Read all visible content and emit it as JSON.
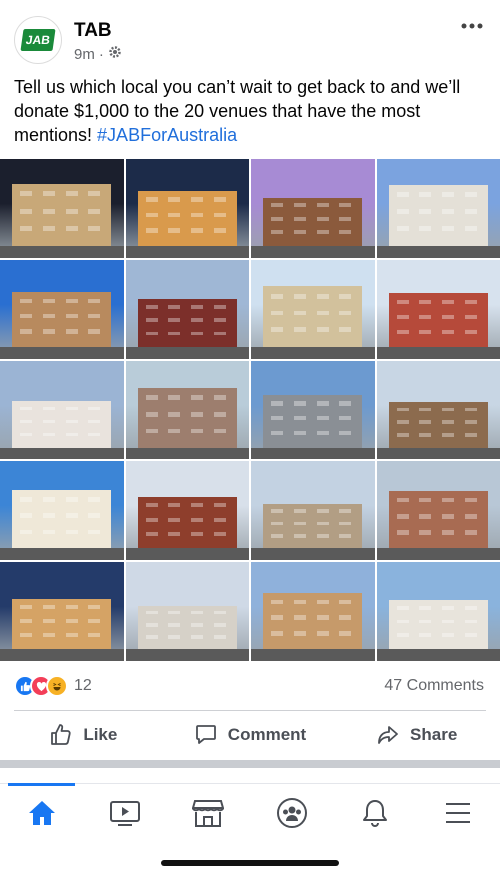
{
  "post": {
    "page_name": "TAB",
    "avatar_text": "JAB",
    "time": "9m",
    "text": "Tell us which local you can’t wait to get back to and we’ll donate $1,000 to the 20 venues that have the most mentions! ",
    "hashtag": "#JABForAustralia"
  },
  "photos": [
    {
      "sky": "#1b1f2d",
      "body": "#c8a878"
    },
    {
      "sky": "#1c2b49",
      "body": "#d99a4c"
    },
    {
      "sky": "#a78bd4",
      "body": "#8b5a3c"
    },
    {
      "sky": "#7ba3df",
      "body": "#e4e0d7"
    },
    {
      "sky": "#2a6fd1",
      "body": "#b88a5e"
    },
    {
      "sky": "#9fb7d5",
      "body": "#7c2f2a"
    },
    {
      "sky": "#cfe0f0",
      "body": "#d2c19c"
    },
    {
      "sky": "#d7e2ee",
      "body": "#b64a3a"
    },
    {
      "sky": "#9bb4d4",
      "body": "#e9e3dd"
    },
    {
      "sky": "#b9ccd9",
      "body": "#9d7e6e"
    },
    {
      "sky": "#6c9ad0",
      "body": "#8a8f95"
    },
    {
      "sky": "#c8d6e4",
      "body": "#8c6b4e"
    },
    {
      "sky": "#3c85d6",
      "body": "#efe8d8"
    },
    {
      "sky": "#d8e0ea",
      "body": "#8e3e2c"
    },
    {
      "sky": "#c3d2e2",
      "body": "#b29e84"
    },
    {
      "sky": "#b8c7d6",
      "body": "#a86b52"
    },
    {
      "sky": "#243b6a",
      "body": "#d5a365"
    },
    {
      "sky": "#cfd9e6",
      "body": "#d6d1c8"
    },
    {
      "sky": "#8fb1db",
      "body": "#c69a6a"
    },
    {
      "sky": "#8ab3dd",
      "body": "#e8e4dc"
    }
  ],
  "reactions": {
    "count": "12",
    "comments": "47 Comments"
  },
  "actions": {
    "like": "Like",
    "comment": "Comment",
    "share": "Share"
  },
  "colors": {
    "accent": "#1877f2",
    "hashtag": "#216fdb",
    "brand_green": "#1a8a3a"
  }
}
